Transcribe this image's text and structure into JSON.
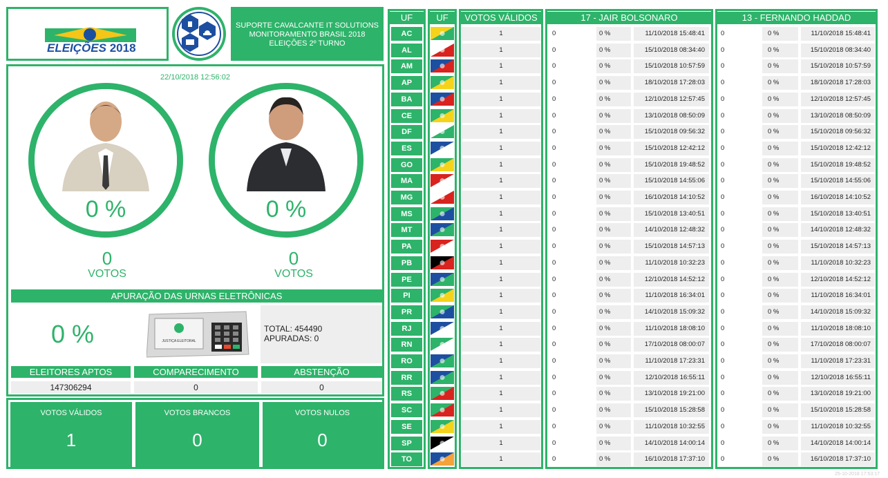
{
  "header": {
    "logo_text_a": "ELEIÇÕES",
    "logo_text_b": "2018",
    "line1": "SUPORTE CAVALCANTE IT SOLUTIONS",
    "line2": "MONITORAMENTO BRASIL 2018",
    "line3": "ELEIÇÕES 2º TURNO"
  },
  "main": {
    "datetime": "22/10/2018 12:56:02",
    "candidates": [
      {
        "pct": "0 %",
        "votes": "0",
        "votes_label": "VOTOS"
      },
      {
        "pct": "0 %",
        "votes": "0",
        "votes_label": "VOTOS"
      }
    ],
    "apuracao_title": "APURAÇÃO DAS URNAS ELETRÔNICAS",
    "apuracao_pct": "0 %",
    "urna_label": "JUSTIÇA ELEITORAL",
    "total": "TOTAL: 454490",
    "apuradas": "APURADAS: 0",
    "stats": [
      {
        "label": "ELEITORES APTOS",
        "value": "147306294"
      },
      {
        "label": "COMPARECIMENTO",
        "value": "0"
      },
      {
        "label": "ABSTENÇÃO",
        "value": "0"
      }
    ],
    "votes": [
      {
        "label": "VOTOS VÁLIDOS",
        "value": "1"
      },
      {
        "label": "VOTOS BRANCOS",
        "value": "0"
      },
      {
        "label": "VOTOS NULOS",
        "value": "0"
      }
    ]
  },
  "table": {
    "h_uf": "UF",
    "h_flag": "UF",
    "h_validos": "VOTOS VÁLIDOS",
    "h_cand1": "17 - JAIR BOLSONARO",
    "h_cand2": "13 - FERNANDO HADDAD",
    "rows": [
      {
        "uf": "AC",
        "validos": "1",
        "c1v": "0",
        "c1p": "0 %",
        "c1t": "11/10/2018 15:48:41",
        "c2v": "0",
        "c2p": "0 %",
        "c2t": "11/10/2018 15:48:41"
      },
      {
        "uf": "AL",
        "validos": "1",
        "c1v": "0",
        "c1p": "0 %",
        "c1t": "15/10/2018 08:34:40",
        "c2v": "0",
        "c2p": "0 %",
        "c2t": "15/10/2018 08:34:40"
      },
      {
        "uf": "AM",
        "validos": "1",
        "c1v": "0",
        "c1p": "0 %",
        "c1t": "15/10/2018 10:57:59",
        "c2v": "0",
        "c2p": "0 %",
        "c2t": "15/10/2018 10:57:59"
      },
      {
        "uf": "AP",
        "validos": "1",
        "c1v": "0",
        "c1p": "0 %",
        "c1t": "18/10/2018 17:28:03",
        "c2v": "0",
        "c2p": "0 %",
        "c2t": "18/10/2018 17:28:03"
      },
      {
        "uf": "BA",
        "validos": "1",
        "c1v": "0",
        "c1p": "0 %",
        "c1t": "12/10/2018 12:57:45",
        "c2v": "0",
        "c2p": "0 %",
        "c2t": "12/10/2018 12:57:45"
      },
      {
        "uf": "CE",
        "validos": "1",
        "c1v": "0",
        "c1p": "0 %",
        "c1t": "13/10/2018 08:50:09",
        "c2v": "0",
        "c2p": "0 %",
        "c2t": "13/10/2018 08:50:09"
      },
      {
        "uf": "DF",
        "validos": "1",
        "c1v": "0",
        "c1p": "0 %",
        "c1t": "15/10/2018 09:56:32",
        "c2v": "0",
        "c2p": "0 %",
        "c2t": "15/10/2018 09:56:32"
      },
      {
        "uf": "ES",
        "validos": "1",
        "c1v": "0",
        "c1p": "0 %",
        "c1t": "15/10/2018 12:42:12",
        "c2v": "0",
        "c2p": "0 %",
        "c2t": "15/10/2018 12:42:12"
      },
      {
        "uf": "GO",
        "validos": "1",
        "c1v": "0",
        "c1p": "0 %",
        "c1t": "15/10/2018 19:48:52",
        "c2v": "0",
        "c2p": "0 %",
        "c2t": "15/10/2018 19:48:52"
      },
      {
        "uf": "MA",
        "validos": "1",
        "c1v": "0",
        "c1p": "0 %",
        "c1t": "15/10/2018 14:55:06",
        "c2v": "0",
        "c2p": "0 %",
        "c2t": "15/10/2018 14:55:06"
      },
      {
        "uf": "MG",
        "validos": "1",
        "c1v": "0",
        "c1p": "0 %",
        "c1t": "16/10/2018 14:10:52",
        "c2v": "0",
        "c2p": "0 %",
        "c2t": "16/10/2018 14:10:52"
      },
      {
        "uf": "MS",
        "validos": "1",
        "c1v": "0",
        "c1p": "0 %",
        "c1t": "15/10/2018 13:40:51",
        "c2v": "0",
        "c2p": "0 %",
        "c2t": "15/10/2018 13:40:51"
      },
      {
        "uf": "MT",
        "validos": "1",
        "c1v": "0",
        "c1p": "0 %",
        "c1t": "14/10/2018 12:48:32",
        "c2v": "0",
        "c2p": "0 %",
        "c2t": "14/10/2018 12:48:32"
      },
      {
        "uf": "PA",
        "validos": "1",
        "c1v": "0",
        "c1p": "0 %",
        "c1t": "15/10/2018 14:57:13",
        "c2v": "0",
        "c2p": "0 %",
        "c2t": "15/10/2018 14:57:13"
      },
      {
        "uf": "PB",
        "validos": "1",
        "c1v": "0",
        "c1p": "0 %",
        "c1t": "11/10/2018 10:32:23",
        "c2v": "0",
        "c2p": "0 %",
        "c2t": "11/10/2018 10:32:23"
      },
      {
        "uf": "PE",
        "validos": "1",
        "c1v": "0",
        "c1p": "0 %",
        "c1t": "12/10/2018 14:52:12",
        "c2v": "0",
        "c2p": "0 %",
        "c2t": "12/10/2018 14:52:12"
      },
      {
        "uf": "PI",
        "validos": "1",
        "c1v": "0",
        "c1p": "0 %",
        "c1t": "11/10/2018 16:34:01",
        "c2v": "0",
        "c2p": "0 %",
        "c2t": "11/10/2018 16:34:01"
      },
      {
        "uf": "PR",
        "validos": "1",
        "c1v": "0",
        "c1p": "0 %",
        "c1t": "14/10/2018 15:09:32",
        "c2v": "0",
        "c2p": "0 %",
        "c2t": "14/10/2018 15:09:32"
      },
      {
        "uf": "RJ",
        "validos": "1",
        "c1v": "0",
        "c1p": "0 %",
        "c1t": "11/10/2018 18:08:10",
        "c2v": "0",
        "c2p": "0 %",
        "c2t": "11/10/2018 18:08:10"
      },
      {
        "uf": "RN",
        "validos": "1",
        "c1v": "0",
        "c1p": "0 %",
        "c1t": "17/10/2018 08:00:07",
        "c2v": "0",
        "c2p": "0 %",
        "c2t": "17/10/2018 08:00:07"
      },
      {
        "uf": "RO",
        "validos": "1",
        "c1v": "0",
        "c1p": "0 %",
        "c1t": "11/10/2018 17:23:31",
        "c2v": "0",
        "c2p": "0 %",
        "c2t": "11/10/2018 17:23:31"
      },
      {
        "uf": "RR",
        "validos": "1",
        "c1v": "0",
        "c1p": "0 %",
        "c1t": "12/10/2018 16:55:11",
        "c2v": "0",
        "c2p": "0 %",
        "c2t": "12/10/2018 16:55:11"
      },
      {
        "uf": "RS",
        "validos": "1",
        "c1v": "0",
        "c1p": "0 %",
        "c1t": "13/10/2018 19:21:00",
        "c2v": "0",
        "c2p": "0 %",
        "c2t": "13/10/2018 19:21:00"
      },
      {
        "uf": "SC",
        "validos": "1",
        "c1v": "0",
        "c1p": "0 %",
        "c1t": "15/10/2018 15:28:58",
        "c2v": "0",
        "c2p": "0 %",
        "c2t": "15/10/2018 15:28:58"
      },
      {
        "uf": "SE",
        "validos": "1",
        "c1v": "0",
        "c1p": "0 %",
        "c1t": "11/10/2018 10:32:55",
        "c2v": "0",
        "c2p": "0 %",
        "c2t": "11/10/2018 10:32:55"
      },
      {
        "uf": "SP",
        "validos": "1",
        "c1v": "0",
        "c1p": "0 %",
        "c1t": "14/10/2018 14:00:14",
        "c2v": "0",
        "c2p": "0 %",
        "c2t": "14/10/2018 14:00:14"
      },
      {
        "uf": "TO",
        "validos": "1",
        "c1v": "0",
        "c1p": "0 %",
        "c1t": "16/10/2018 17:37:10",
        "c2v": "0",
        "c2p": "0 %",
        "c2t": "16/10/2018 17:37:10"
      }
    ]
  },
  "footer": {
    "timestamp": "25-10-2018 17:53:17"
  },
  "colors": {
    "accent": "#2eb36a",
    "cell_bg": "#eeeeee"
  }
}
